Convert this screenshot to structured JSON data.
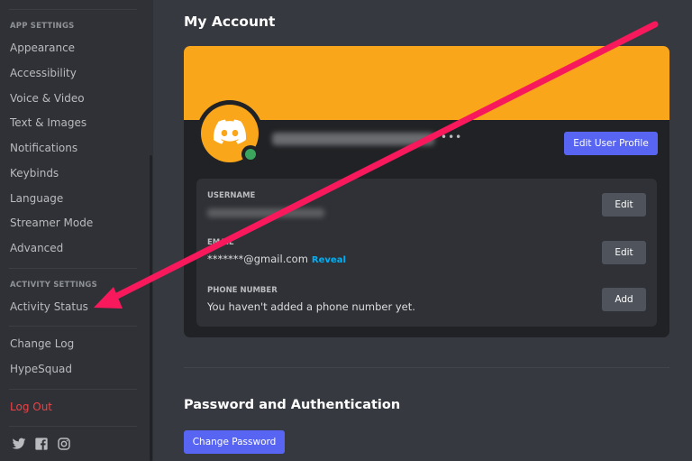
{
  "sidebar": {
    "app_settings_header": "App Settings",
    "app_settings_items": [
      {
        "label": "Appearance"
      },
      {
        "label": "Accessibility"
      },
      {
        "label": "Voice & Video"
      },
      {
        "label": "Text & Images"
      },
      {
        "label": "Notifications"
      },
      {
        "label": "Keybinds"
      },
      {
        "label": "Language"
      },
      {
        "label": "Streamer Mode"
      },
      {
        "label": "Advanced"
      }
    ],
    "activity_settings_header": "Activity Settings",
    "activity_settings_items": [
      {
        "label": "Activity Status"
      }
    ],
    "misc_items": [
      {
        "label": "Change Log"
      },
      {
        "label": "HypeSquad"
      }
    ],
    "logout_label": "Log Out",
    "social_icons": [
      "twitter-icon",
      "facebook-icon",
      "instagram-icon"
    ]
  },
  "main": {
    "title": "My Account",
    "profile": {
      "banner_color": "#faa61a",
      "avatar_color": "#faa61a",
      "avatar_icon": "discord-logo-icon",
      "status": "online",
      "status_color": "#3ba55d",
      "more_label": "•••",
      "edit_profile_label": "Edit User Profile"
    },
    "fields": [
      {
        "label": "Username",
        "value": "",
        "blurred": true,
        "button": "Edit"
      },
      {
        "label": "Email",
        "value": "*******@gmail.com",
        "reveal_label": "Reveal",
        "button": "Edit"
      },
      {
        "label": "Phone Number",
        "value": "You haven't added a phone number yet.",
        "button": "Add"
      }
    ],
    "password_section": {
      "title": "Password and Authentication",
      "change_password_label": "Change Password"
    }
  },
  "annotation": {
    "type": "arrow",
    "color": "#f7195b",
    "points_to": "Activity Status"
  }
}
